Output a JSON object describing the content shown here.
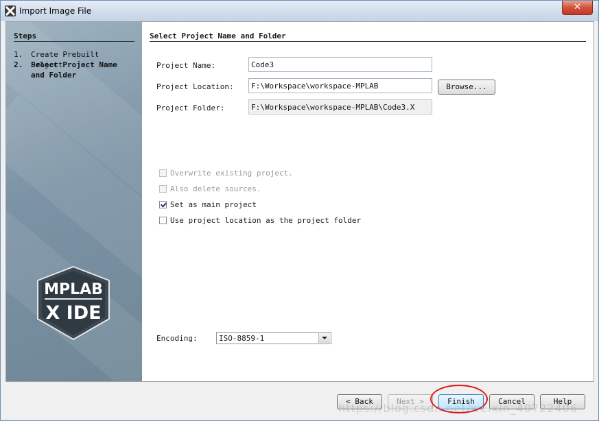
{
  "window": {
    "title": "Import Image File",
    "icon": "mplab-x-icon",
    "close_label": "✕"
  },
  "steps": {
    "title": "Steps",
    "items": [
      {
        "num": "1.",
        "label": "Create Prebuilt Project",
        "current": false
      },
      {
        "num": "2.",
        "label": "Select Project Name and Folder",
        "current": true
      }
    ],
    "logo_top": "MPLAB",
    "logo_bottom": "X IDE"
  },
  "main": {
    "title": "Select Project Name and Folder",
    "project_name_label": "Project Name:",
    "project_name_value": "Code3",
    "project_location_label": "Project Location:",
    "project_location_value": "F:\\Workspace\\workspace-MPLAB",
    "browse_label": "Browse...",
    "project_folder_label": "Project Folder:",
    "project_folder_value": "F:\\Workspace\\workspace-MPLAB\\Code3.X",
    "options": [
      {
        "label": "Overwrite existing project.",
        "checked": false,
        "enabled": false
      },
      {
        "label": "Also delete sources.",
        "checked": false,
        "enabled": false
      },
      {
        "label": "Set as main project",
        "checked": true,
        "enabled": true
      },
      {
        "label": "Use project location as the project folder",
        "checked": false,
        "enabled": true
      }
    ],
    "encoding_label": "Encoding:",
    "encoding_value": "ISO-8859-1"
  },
  "buttons": {
    "back": "< Back",
    "next": "Next >",
    "finish": "Finish",
    "cancel": "Cancel",
    "help": "Help"
  },
  "watermark": "https://blog.csdn.net/weixin_40722406",
  "colors": {
    "steps_panel": "#7c93a5",
    "highlight_ring": "#e0161c",
    "default_button": "#bee6fd"
  }
}
